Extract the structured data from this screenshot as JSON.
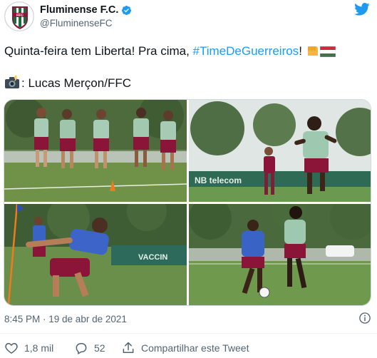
{
  "author": {
    "display_name": "Fluminense F.C.",
    "handle": "@FluminenseFC",
    "verified": true,
    "avatar_icon": "fluminense-crest-icon"
  },
  "brand": {
    "icon": "twitter-bird-icon",
    "color": "#1d9bf0"
  },
  "tweet": {
    "line1_text": "Quinta-feira tem Liberta! Pra cima, ",
    "hashtag": "#TimeDeGuerreiros",
    "line1_end": "!",
    "emojis_line1": [
      "raised-fist-emoji",
      "hungary-flag-emoji"
    ],
    "camera_emoji": "camera-flash-emoji",
    "credit": ": Lucas Merçon/FFC"
  },
  "media": {
    "photos": [
      {
        "name": "photo-players-walking",
        "alt_icon": "photo"
      },
      {
        "name": "photo-player-running",
        "alt_icon": "photo"
      },
      {
        "name": "photo-player-stretching",
        "alt_icon": "photo"
      },
      {
        "name": "photo-players-dribbling",
        "alt_icon": "photo"
      }
    ]
  },
  "meta": {
    "timestamp": "8:45 PM · 19 de abr de 2021",
    "info_icon": "info-icon"
  },
  "actions": {
    "like_count": "1,8 mil",
    "reply_count": "52",
    "share_label": "Compartilhar este Tweet"
  },
  "colors": {
    "accent": "#1d9bf0",
    "muted": "#536471",
    "club_maroon": "#8a1538",
    "club_green": "#1b6b3a"
  }
}
